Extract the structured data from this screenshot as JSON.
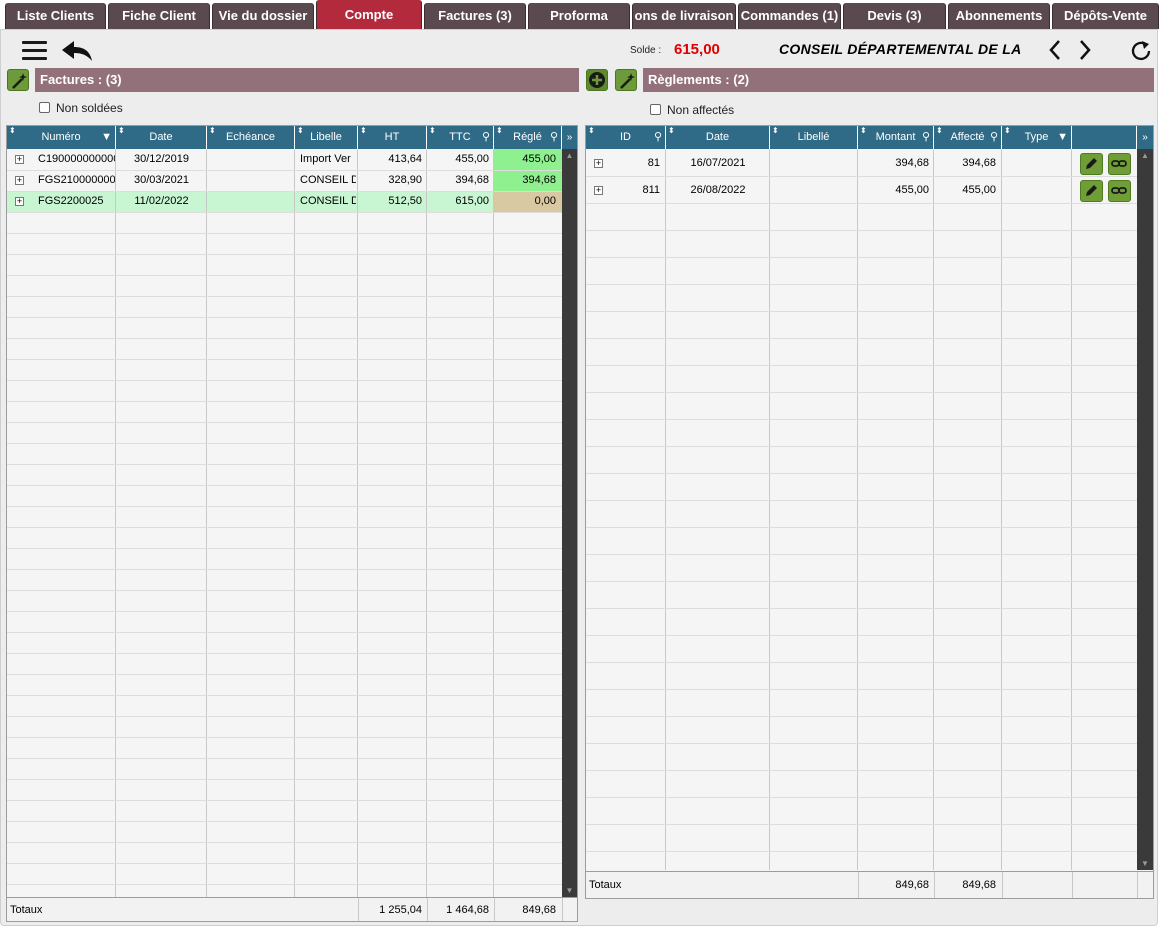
{
  "tabs": [
    {
      "label": "Liste Clients",
      "active": false
    },
    {
      "label": "Fiche Client",
      "active": false
    },
    {
      "label": "Vie du dossier",
      "active": false
    },
    {
      "label": "Compte",
      "active": true
    },
    {
      "label": "Factures (3)",
      "active": false
    },
    {
      "label": "Proforma",
      "active": false
    },
    {
      "label": "ons de livraison",
      "active": false
    },
    {
      "label": "Commandes (1)",
      "active": false
    },
    {
      "label": "Devis (3)",
      "active": false
    },
    {
      "label": "Abonnements",
      "active": false
    },
    {
      "label": "Dépôts-Vente",
      "active": false
    }
  ],
  "toolbar": {
    "solde_label": "Solde :",
    "solde_value": "615,00",
    "client_name": "CONSEIL DÉPARTEMENTAL DE LA"
  },
  "factures": {
    "title": "Factures : (3)",
    "filter_label": "Non soldées",
    "columns": [
      "Numéro",
      "Date",
      "Echéance",
      "Libelle",
      "HT",
      "TTC",
      "Réglé"
    ],
    "rows": [
      {
        "numero": "C190000000000",
        "date": "30/12/2019",
        "echeance": "",
        "libelle": "Import Ver",
        "ht": "413,64",
        "ttc": "455,00",
        "regle": "455,00",
        "status": "paid"
      },
      {
        "numero": "FGS210000000",
        "date": "30/03/2021",
        "echeance": "",
        "libelle": "CONSEIL D",
        "ht": "328,90",
        "ttc": "394,68",
        "regle": "394,68",
        "status": "paid"
      },
      {
        "numero": "FGS2200025",
        "date": "11/02/2022",
        "echeance": "",
        "libelle": "CONSEIL D",
        "ht": "512,50",
        "ttc": "615,00",
        "regle": "0,00",
        "status": "unpaid"
      }
    ],
    "totals": {
      "label": "Totaux",
      "ht": "1 255,04",
      "ttc": "1 464,68",
      "regle": "849,68"
    }
  },
  "reglements": {
    "title": "Règlements : (2)",
    "filter_label": "Non affectés",
    "columns": [
      "ID",
      "Date",
      "Libellé",
      "Montant",
      "Affecté",
      "Type"
    ],
    "rows": [
      {
        "id": "81",
        "date": "16/07/2021",
        "libelle": "",
        "montant": "394,68",
        "affecte": "394,68",
        "type": ""
      },
      {
        "id": "811",
        "date": "26/08/2022",
        "libelle": "",
        "montant": "455,00",
        "affecte": "455,00",
        "type": ""
      }
    ],
    "totals": {
      "label": "Totaux",
      "montant": "849,68",
      "affecte": "849,68"
    }
  },
  "colors": {
    "tab_bg": "#5a4a4f",
    "tab_active": "#b22a3c",
    "section_header": "#93717b",
    "grid_header": "#2f6b86",
    "paid_green": "#8ef08e",
    "selected_row": "#c8f5d2",
    "unpaid_tan": "#d9c9a3",
    "solde_red": "#e00000",
    "action_green": "#6f9e36"
  }
}
